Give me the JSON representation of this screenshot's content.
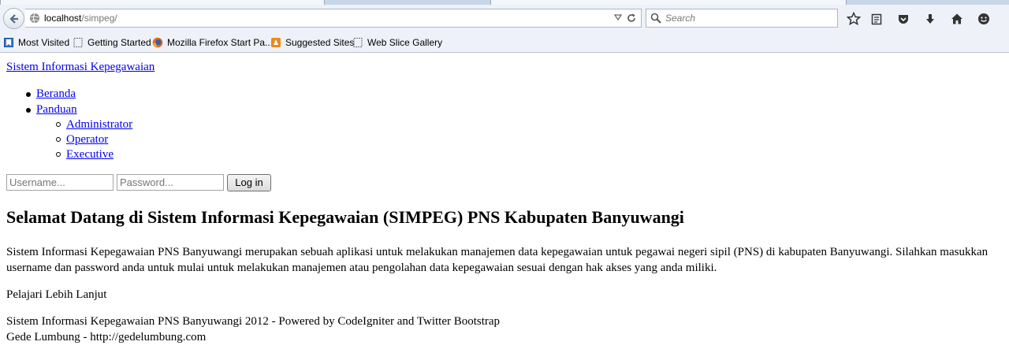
{
  "browser": {
    "url_host": "localhost",
    "url_path": "/simpeg/",
    "search_placeholder": "Search",
    "bookmarks": [
      "Most Visited",
      "Getting Started",
      "Mozilla Firefox Start Pa...",
      "Suggested Sites",
      "Web Slice Gallery"
    ]
  },
  "page": {
    "site_title": "Sistem Informasi Kepegawaian",
    "nav": {
      "home": "Beranda",
      "guide": "Panduan",
      "guide_items": [
        "Administrator",
        "Operator",
        "Executive"
      ]
    },
    "login": {
      "username_placeholder": "Username...",
      "password_placeholder": "Password...",
      "button_label": "Log in"
    },
    "heading": "Selamat Datang di Sistem Informasi Kepegawaian (SIMPEG) PNS Kabupaten Banyuwangi",
    "intro_line1": "Sistem Informasi Kepegawaian PNS Banyuwangi merupakan sebuah aplikasi untuk melakukan manajemen data kepegawaian untuk pegawai negeri sipil (PNS) di kabupaten Banyuwangi. Silahkan masukkan",
    "intro_line2": "username dan password anda untuk mulai untuk melakukan manajemen atau pengolahan data kepegawaian sesuai dengan hak akses yang anda miliki.",
    "learn_more": "Pelajari Lebih Lanjut",
    "footer_line1": "Sistem Informasi Kepegawaian PNS Banyuwangi 2012 - Powered by CodeIgniter and Twitter Bootstrap",
    "footer_line2": "Gede Lumbung - http://gedelumbung.com"
  }
}
